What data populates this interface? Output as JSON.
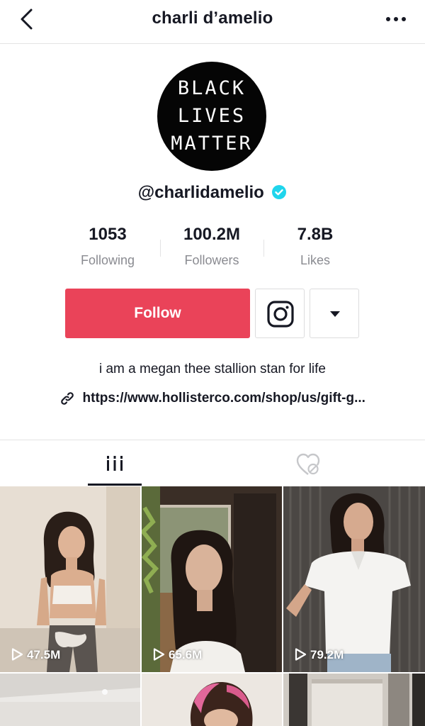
{
  "header": {
    "title": "charli d’amelio"
  },
  "profile": {
    "avatar_text_lines": [
      "BLACK",
      "LIVES",
      "MATTER"
    ],
    "handle": "@charlidamelio",
    "verified": true
  },
  "stats": [
    {
      "value": "1053",
      "label": "Following"
    },
    {
      "value": "100.2M",
      "label": "Followers"
    },
    {
      "value": "7.8B",
      "label": "Likes"
    }
  ],
  "actions": {
    "follow_label": "Follow",
    "instagram_icon": "instagram-icon",
    "dropdown_icon": "caret-down-icon"
  },
  "bio": {
    "text": "i am a megan thee stallion stan for life",
    "link": "https://www.hollisterco.com/shop/us/gift-g..."
  },
  "tabs": [
    {
      "name": "videos",
      "icon": "grid-icon",
      "active": true
    },
    {
      "name": "liked",
      "icon": "liked-hidden-icon",
      "active": false
    }
  ],
  "videos": [
    {
      "views": "47.5M"
    },
    {
      "views": "65.6M"
    },
    {
      "views": "79.2M"
    },
    {
      "views": ""
    },
    {
      "views": ""
    },
    {
      "views": ""
    }
  ],
  "colors": {
    "accent": "#ea4359",
    "verified": "#20d5ec",
    "text": "#161823",
    "muted": "#8a8b91"
  }
}
